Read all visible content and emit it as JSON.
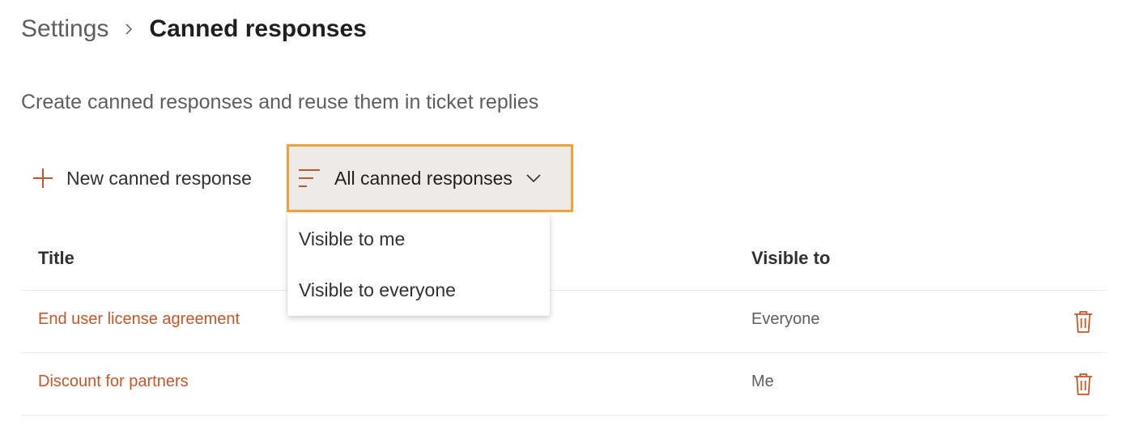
{
  "breadcrumb": {
    "root": "Settings",
    "current": "Canned responses"
  },
  "description": "Create canned responses and reuse them in ticket replies",
  "toolbar": {
    "new_label": "New canned response",
    "filter_label": "All canned responses"
  },
  "dropdown": {
    "options": [
      "Visible to me",
      "Visible to everyone"
    ]
  },
  "table": {
    "columns": {
      "title": "Title",
      "visible_to": "Visible to"
    },
    "rows": [
      {
        "title": "End user license agreement",
        "visible_to": "Everyone"
      },
      {
        "title": "Discount for partners",
        "visible_to": "Me"
      }
    ]
  },
  "colors": {
    "accent": "#c4572a",
    "focus_border": "#f0a33a",
    "filter_bg": "#edebe9"
  },
  "icons": {
    "new": "plus-icon",
    "filter": "filter-lines-icon",
    "chevron": "chevron-down-icon",
    "delete": "trash-icon",
    "separator": "chevron-right-icon"
  }
}
